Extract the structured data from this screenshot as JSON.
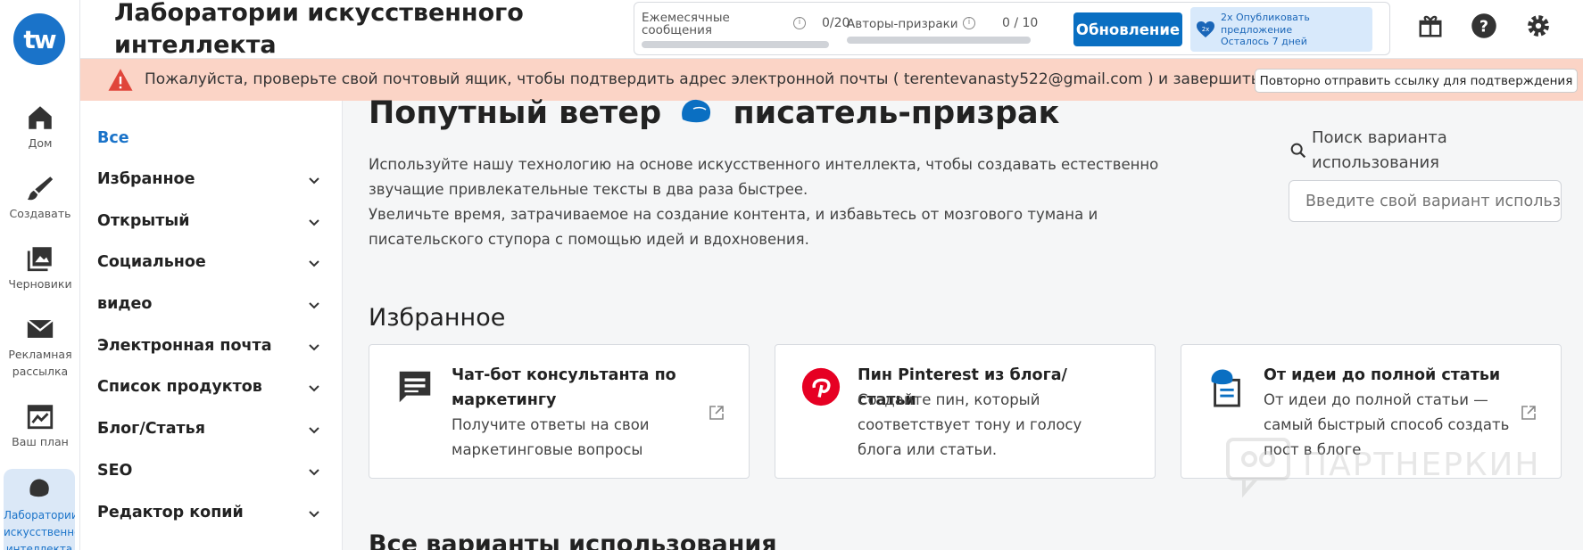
{
  "header": {
    "title": "Лаборатории искусственного интеллекта",
    "logo_text": "tw",
    "usage": {
      "monthly_label": "Ежемесячные сообщения",
      "monthly_value": "0/20",
      "monthly_progress": 0,
      "ghost_label": "Авторы-призраки",
      "ghost_value": "0 / 10",
      "ghost_progress": 0
    },
    "upgrade_label": "Обновление",
    "promo": {
      "badge": "2x",
      "line1": "2x Опубликовать",
      "line2": "предложение",
      "line3": "Осталось 7 дней"
    }
  },
  "rail": {
    "items": [
      {
        "label": "Дом",
        "icon": "home-icon"
      },
      {
        "label": "Создавать",
        "icon": "brush-icon"
      },
      {
        "label": "Черновики",
        "icon": "drafts-icon"
      },
      {
        "label": "Рекламная рассылка",
        "icon": "mail-icon"
      },
      {
        "label": "Ваш план",
        "icon": "plan-icon"
      },
      {
        "label": "Лаборатории искусственного интеллекта",
        "icon": "ghost-icon"
      }
    ]
  },
  "banner": {
    "text": "Пожалуйста, проверьте свой почтовый ящик, чтобы подтвердить адрес электронной почты ( terentevanasty522@gmail.com ) и завершить регистрацию!",
    "resend_label": "Повторно отправить ссылку для подтверждения"
  },
  "categories": [
    "Все",
    "Избранное",
    "Открытый",
    "Социальное",
    "видео",
    "Электронная почта",
    "Список продуктов",
    "Блог/Статья",
    "SEO",
    "Редактор копий"
  ],
  "main": {
    "title_part1": "Попутный ветер",
    "title_part2": "писатель-призрак",
    "intro1": "Используйте нашу технологию на основе искусственного интеллекта, чтобы создавать естественно звучащие привлекательные тексты в два раза быстрее.",
    "intro2": "Увеличьте время, затрачиваемое на создание контента, и избавьтесь от мозгового тумана и писательского ступора с помощью идей и вдохновения.",
    "search_label": "Поиск варианта использования",
    "search_placeholder": "Введите свой вариант использования",
    "favorites_heading": "Избранное",
    "all_heading": "Все варианты использования",
    "cards": [
      {
        "title": "Чат-бот консультанта по маркетингу",
        "desc": "Получите ответы на свои маркетинговые вопросы",
        "icon": "chat-icon"
      },
      {
        "title": "Пин Pinterest из блога/статьи",
        "desc": "Создайте пин, который соответствует тону и голосу блога или статьи.",
        "icon": "pinterest-icon"
      },
      {
        "title": "От идеи до полной статьи",
        "desc": "От идеи до полной статьи — самый быстрый способ создать пост в блоге",
        "icon": "ghost-article-icon"
      }
    ]
  },
  "watermark": "ПАРТНЕРКИН",
  "colors": {
    "accent": "#1a73c9",
    "banner": "#fbd4c6",
    "upgrade": "#0a6fc2",
    "pinterest": "#e60023"
  }
}
